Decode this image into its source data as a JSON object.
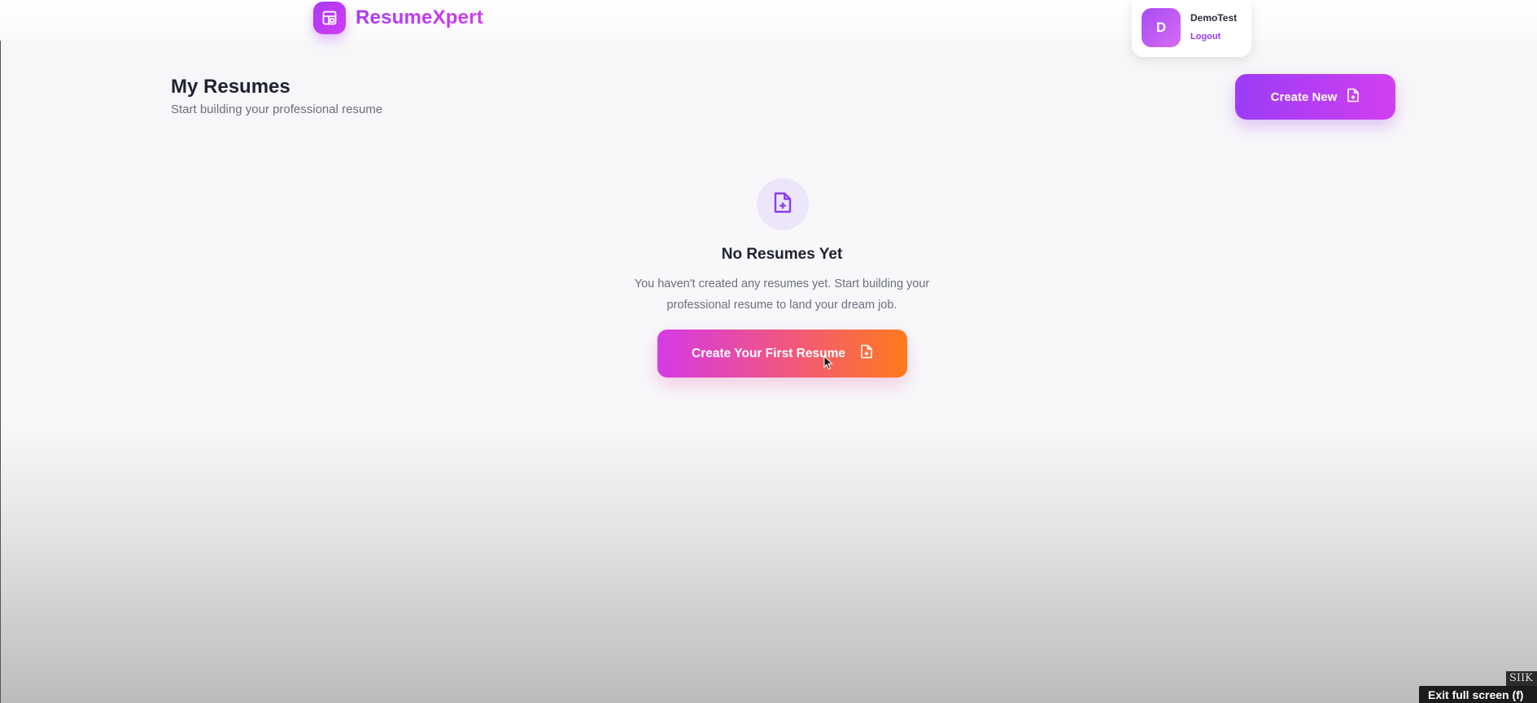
{
  "app": {
    "brand": "ResumeXpert",
    "brand_icon": "layout-template-icon"
  },
  "user": {
    "initial": "D",
    "name": "DemoTest",
    "logout_label": "Logout"
  },
  "page": {
    "title": "My Resumes",
    "subtitle": "Start building your professional resume",
    "create_new_label": "Create New",
    "create_new_icon": "file-plus-icon"
  },
  "empty_state": {
    "icon": "file-plus-icon",
    "title": "No Resumes Yet",
    "text_line1": "You haven't created any resumes yet. Start building your",
    "text_line2": "professional resume to land your dream job.",
    "button_label": "Create Your First Resume"
  },
  "overlay": {
    "exit_fullscreen": "Exit full screen (f)",
    "corner_text": "SIIK"
  },
  "colors": {
    "brand_purple": "#a93af5",
    "brand_magenta": "#d23cf0",
    "cta_orange": "#ff7a1c"
  }
}
